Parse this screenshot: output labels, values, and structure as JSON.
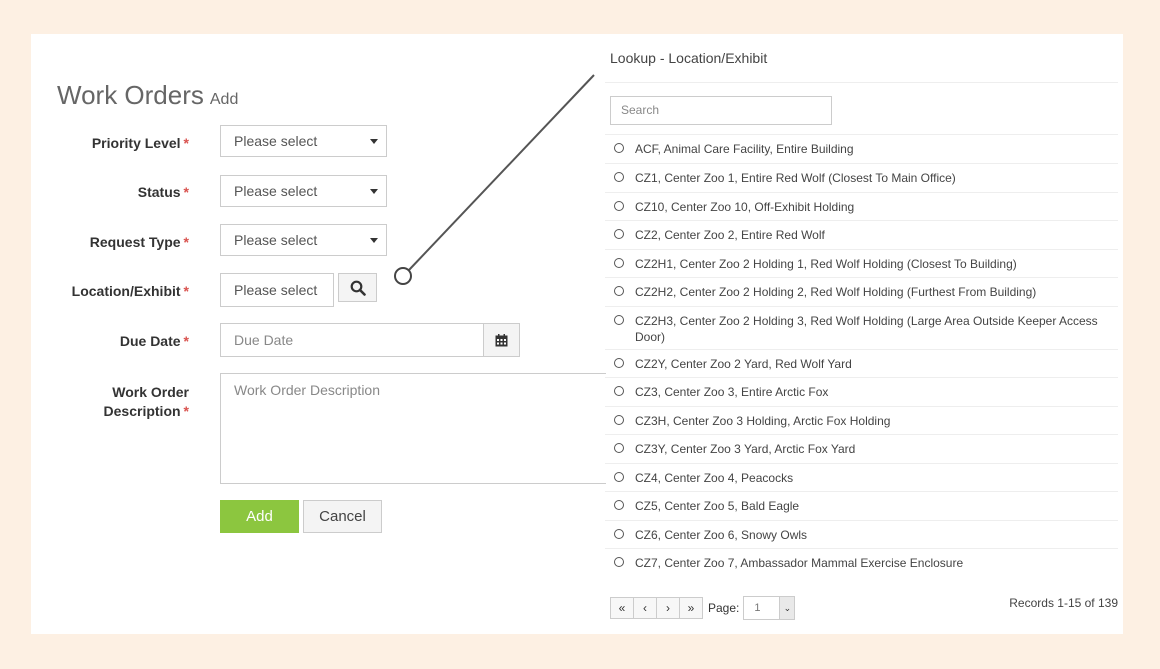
{
  "page": {
    "title": "Work Orders",
    "subtitle": "Add"
  },
  "form": {
    "required_mark": "*",
    "priority": {
      "label": "Priority Level",
      "value": "Please select"
    },
    "status": {
      "label": "Status",
      "value": "Please select"
    },
    "request_type": {
      "label": "Request Type",
      "value": "Please select"
    },
    "location": {
      "label": "Location/Exhibit",
      "value": "Please select"
    },
    "due_date": {
      "label": "Due Date",
      "placeholder": "Due Date"
    },
    "description": {
      "label_line1": "Work Order",
      "label_line2": "Description",
      "placeholder": "Work Order Description"
    },
    "add_label": "Add",
    "cancel_label": "Cancel"
  },
  "lookup": {
    "title": "Lookup - Location/Exhibit",
    "search_placeholder": "Search",
    "items": [
      "ACF, Animal Care Facility, Entire Building",
      "CZ1, Center Zoo 1, Entire Red Wolf (Closest To Main Office)",
      "CZ10, Center Zoo 10, Off-Exhibit Holding",
      "CZ2, Center Zoo 2, Entire Red Wolf",
      "CZ2H1, Center Zoo 2 Holding 1, Red Wolf Holding (Closest To Building)",
      "CZ2H2, Center Zoo 2 Holding 2, Red Wolf Holding (Furthest From Building)",
      "CZ2H3, Center Zoo 2 Holding 3, Red Wolf Holding (Large Area Outside Keeper Access Door)",
      "CZ2Y, Center Zoo 2 Yard, Red Wolf Yard",
      "CZ3, Center Zoo 3, Entire Arctic Fox",
      "CZ3H, Center Zoo 3 Holding, Arctic Fox Holding",
      "CZ3Y, Center Zoo 3 Yard, Arctic Fox Yard",
      "CZ4, Center Zoo 4, Peacocks",
      "CZ5, Center Zoo 5, Bald Eagle",
      "CZ6, Center Zoo 6, Snowy Owls",
      "CZ7, Center Zoo 7, Ambassador Mammal Exercise Enclosure"
    ],
    "pager": {
      "first": "«",
      "prev": "‹",
      "next": "›",
      "last": "»",
      "page_label": "Page:",
      "page_value": "1",
      "records": "Records 1-15 of 139"
    }
  },
  "icons": {
    "search": "search-icon",
    "calendar": "calendar-icon",
    "caret": "caret-down-icon"
  },
  "colors": {
    "background": "#fdf0e3",
    "accent_green": "#8cc63f",
    "required_red": "#d9534f"
  }
}
